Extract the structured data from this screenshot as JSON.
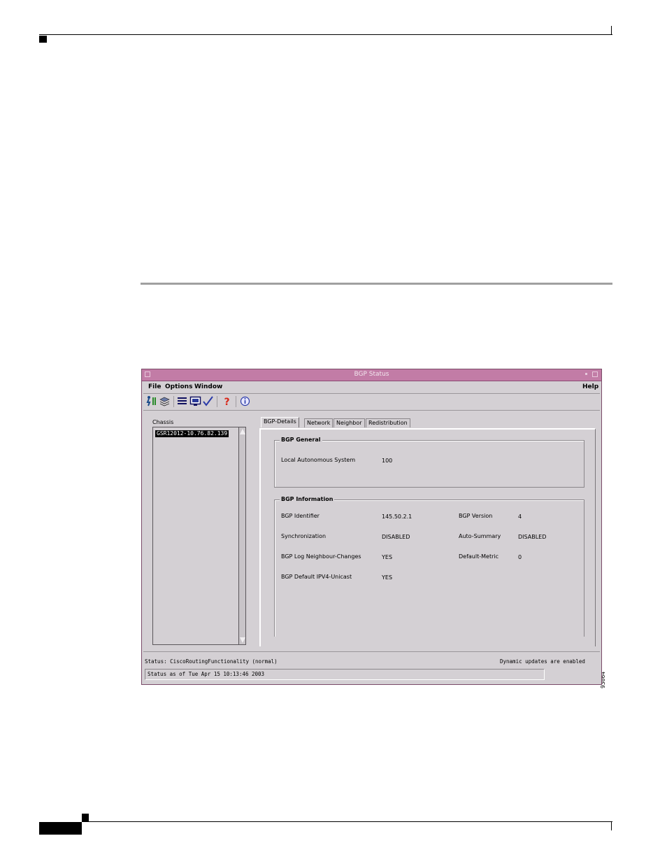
{
  "window": {
    "title": "BGP Status"
  },
  "menu": {
    "file": "File",
    "options": "Options",
    "window": "Window",
    "help": "Help"
  },
  "toolbar": {
    "icons": [
      "run-icon",
      "layers-icon",
      "list-icon",
      "monitor-icon",
      "check-icon",
      "question-icon",
      "info-icon"
    ]
  },
  "chassis": {
    "label": "Chassis",
    "items": [
      "GSR12012-10.76.82.139"
    ]
  },
  "tabs": [
    "BGP-Details",
    "Network",
    "Neighbor",
    "Redistribution"
  ],
  "bgp_general": {
    "title": "BGP General",
    "local_as_label": "Local Autonomous System",
    "local_as_value": "100"
  },
  "bgp_information": {
    "title": "BGP Information",
    "identifier_label": "BGP Identifier",
    "identifier_value": "145.50.2.1",
    "version_label": "BGP Version",
    "version_value": "4",
    "sync_label": "Synchronization",
    "sync_value": "DISABLED",
    "autosum_label": "Auto-Summary",
    "autosum_value": "DISABLED",
    "log_label": "BGP Log Neighbour-Changes",
    "log_value": "YES",
    "metric_label": "Default-Metric",
    "metric_value": "0",
    "ipv4_label": "BGP Default IPV4-Unicast",
    "ipv4_value": "YES"
  },
  "status": {
    "text": "Status: CiscoRoutingFunctionality (normal)",
    "dynamic": "Dynamic updates are enabled",
    "timestamp": "Status as of Tue Apr 15 10:13:46 2003"
  },
  "figure_id": "93064",
  "colors": {
    "titlebar": "#c27ca6",
    "window_bg": "#d4d0d4"
  }
}
